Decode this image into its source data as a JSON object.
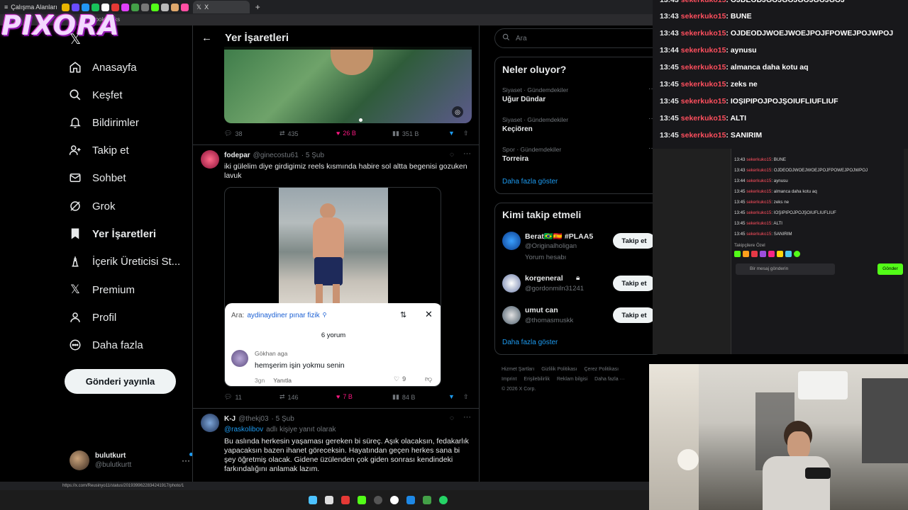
{
  "browser": {
    "workspace_label": "Çalışma Alanları",
    "bookmarks_label": "bookmarks",
    "tab_x_label": "X",
    "status_url": "https://x.com/Reusinyo11/status/2019399622834241917/photo/1"
  },
  "overlay_logo": "PIXORA",
  "nav": {
    "items": [
      {
        "label": "Anasayfa",
        "icon": "home-icon"
      },
      {
        "label": "Keşfet",
        "icon": "search-icon"
      },
      {
        "label": "Bildirimler",
        "icon": "bell-icon"
      },
      {
        "label": "Takip et",
        "icon": "follow-icon"
      },
      {
        "label": "Sohbet",
        "icon": "mail-icon"
      },
      {
        "label": "Grok",
        "icon": "grok-icon"
      },
      {
        "label": "Yer İşaretleri",
        "icon": "bookmark-icon"
      },
      {
        "label": "İçerik Üreticisi St...",
        "icon": "creator-icon"
      },
      {
        "label": "Premium",
        "icon": "x-icon"
      },
      {
        "label": "Profil",
        "icon": "person-icon"
      },
      {
        "label": "Daha fazla",
        "icon": "more-icon"
      }
    ],
    "post_button": "Gönderi yayınla",
    "account_name": "bulutkurt",
    "account_handle": "@bulutkurtt"
  },
  "timeline": {
    "title": "Yer İşaretleri",
    "tweet1_actions": {
      "replies": "38",
      "retweets": "435",
      "likes": "26 B",
      "views": "351 B"
    },
    "tweet2": {
      "name": "fodepar",
      "handle": "@ginecostu61",
      "date": "· 5 Şub",
      "text": "iki gülelim diye girdigimiz reels kısmında habire sol altta begenisi gozuken lavuk",
      "search_prefix": "Ara:",
      "search_query": "aydinaydiner pınar fizik",
      "comments_count": "6 yorum",
      "commenter": "Gökhan aga",
      "comment": "hemşerim işin yokmu senin",
      "comment_age": "3gn",
      "comment_reply": "Yanıtla",
      "comment_likes": "9",
      "actions": {
        "replies": "11",
        "retweets": "146",
        "likes": "7 B",
        "views": "84 B"
      }
    },
    "tweet3": {
      "name": "K-J",
      "handle": "@thekj03",
      "date": "· 5 Şub",
      "reply_to_handle": "@raskolibov",
      "reply_to_suffix": "adlı kişiye yanıt olarak",
      "text": "Bu aslında herkesin yaşaması gereken bi süreç. Aşık olacaksın, fedakarlık yapacaksın bazen ihanet göreceksin. Hayatından geçen herkes sana bi şey öğretmiş olacak. Gidene üzülenden çok giden sonrası kendindeki farkındalığını anlamak lazım."
    }
  },
  "right": {
    "search_placeholder": "Ara",
    "trends_title": "Neler oluyor?",
    "trends": [
      {
        "category": "Siyaset · Gündemdekiler",
        "name": "Uğur Dündar"
      },
      {
        "category": "Siyaset · Gündemdekiler",
        "name": "Keçiören"
      },
      {
        "category": "Spor · Gündemdekiler",
        "name": "Torreira"
      }
    ],
    "show_more": "Daha fazla göster",
    "follow_title": "Kimi takip etmeli",
    "follow": [
      {
        "name": "Berat🇧🇷🇪🇸 #PLAA5",
        "handle": "@Originalholigan",
        "extra": "Yorum hesabı"
      },
      {
        "name": "korgeneral",
        "handle": "@gordonmiln31241",
        "extra": ""
      },
      {
        "name": "umut can",
        "handle": "@thomasmuskk",
        "extra": ""
      }
    ],
    "follow_button": "Takip et",
    "footer_links": [
      "Hizmet Şartları",
      "Gizlilik Politikası",
      "Çerez Politikası",
      "Imprint",
      "Erişilebilirlik",
      "Reklam bilgisi",
      "Daha fazla ···"
    ],
    "copyright": "© 2026 X Corp."
  },
  "chat": {
    "messages": [
      {
        "time": "13:43",
        "user": "sekerkuko15",
        "text": ": OJDEODJWOEJWOEJPOJFPOWEJPOJWPOJ"
      },
      {
        "time": "13:44",
        "user": "sekerkuko15",
        "text": ": aynusu"
      },
      {
        "time": "13:45",
        "user": "sekerkuko15",
        "text": ": almanca daha kotu aq"
      },
      {
        "time": "13:45",
        "user": "sekerkuko15",
        "text": ": zeks ne"
      },
      {
        "time": "13:45",
        "user": "sekerkuko15",
        "text": ": IOŞIPIPOJPOJŞOIUFLIUFLIUF"
      },
      {
        "time": "13:45",
        "user": "sekerkuko15",
        "text": ": ALTI"
      },
      {
        "time": "13:45",
        "user": "sekerkuko15",
        "text": ": SANIRIM"
      }
    ],
    "top_line": {
      "time": "13:43",
      "user": "sekerkuko15",
      "text": ": BUNE"
    },
    "mini_followers_label": "Takipçilere Özel",
    "mini_input_placeholder": "Bir mesaj gönderin",
    "mini_send": "Gönder"
  },
  "colors": {
    "accent": "#1d9bf0",
    "like": "#f91880",
    "chat_user": "#ff4f5e"
  }
}
